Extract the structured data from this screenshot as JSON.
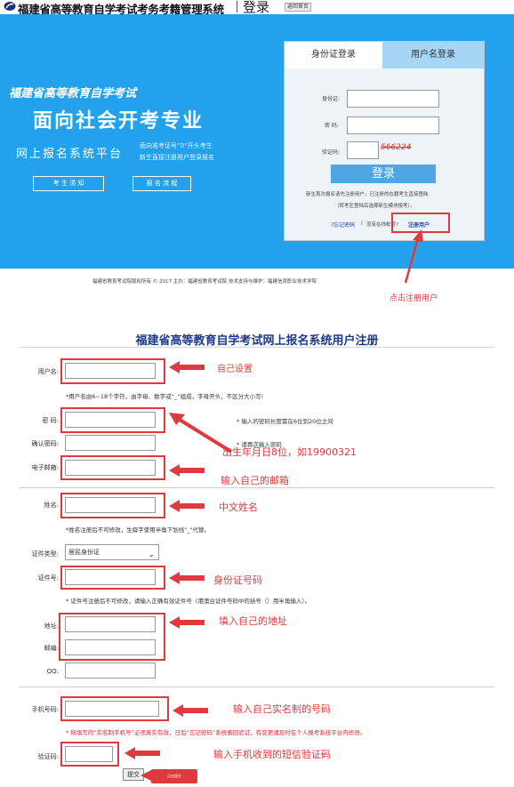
{
  "header": {
    "title": "福建省高等教育自学考试考务考籍管理系统",
    "login_title": "登录",
    "home_link": "返回首页"
  },
  "banner": {
    "subtitle": "福建省高等教育自学考试",
    "main_title": "面向社会开考专业",
    "platform": "网上报名系统平台",
    "note_line1": "面向准考证号“0”开头考生",
    "note_line2": "新生直接注册用户登录报名",
    "btn_notice": "考 生 须 知",
    "btn_process": "报 名 流 程",
    "bg_color": "#23a1ec"
  },
  "login": {
    "tab_id": "身份证登录",
    "tab_user": "用户名登录",
    "label_id": "身份证:",
    "label_pwd": "密  码:",
    "label_code": "验证码:",
    "captcha": "566224",
    "login_btn": "登录",
    "hint1": "新生首次报名请先注册用户，已注册的在籍考生直接登陆",
    "hint2": "（转考区登陆后选择新生模块报考）。",
    "forgot": "?忘记密码",
    "divider": "|",
    "no_account": "没有在线帐号?",
    "register": "注册用户"
  },
  "copyright": "福建省教育考试院版权所有 © 2017    主办：福建省教育考试院    技术支持与维护：福建信息职业技术学院",
  "callout_register": "点击注册用户",
  "register": {
    "title": "福建省高等教育自学考试网上报名系统用户注册",
    "username_label": "用户名:",
    "username_note": "*用户名由6~18个字符，由字母、数字或“_”组成，字母开头，不区分大小写!",
    "password_label": "密    码:",
    "password_note": "* 输入的密码长度需在6位到20位之间",
    "confirm_label": "确认密码:",
    "confirm_note": "* 请再次输入密码",
    "email_label": "电子邮箱:",
    "name_label": "姓名:",
    "name_note": "*姓名注册后不可修改，生僻字使用半角下划线\"_\"代替。",
    "idtype_label": "证件类型:",
    "idtype_value": "居民身份证",
    "idno_label": "证件号:",
    "idno_note": "* 证件号注册后不可修改，请输入正确有效证件号（港澳台证件号码中的括号（）用半角输入）。",
    "address_label": "地址:",
    "zip_label": "邮编:",
    "qq_label": "QQ:",
    "phone_label": "手机号码:",
    "phone_note": "* 所填写的“实名制手机号”必须真实有效，日后“忘记密码”系统索回验证，有变更请及时在个人报考系统平台内修改。",
    "code_label": "验证码:",
    "submit": "提交",
    "submit_callout": "点击提交"
  },
  "annotations": {
    "username": "自己设置",
    "birthday": "出生年月日8位，如19900321",
    "email": "输入自己的邮箱",
    "name": "中文姓名",
    "idno": "身份证号码",
    "address": "填入自己的地址",
    "phone": "输入自己实名制的号码",
    "code": "输入手机收到的短信验证码"
  },
  "colors": {
    "annotation_red": "#e0393e",
    "link_blue": "#2244aa",
    "title_blue": "#1e3a8a"
  }
}
